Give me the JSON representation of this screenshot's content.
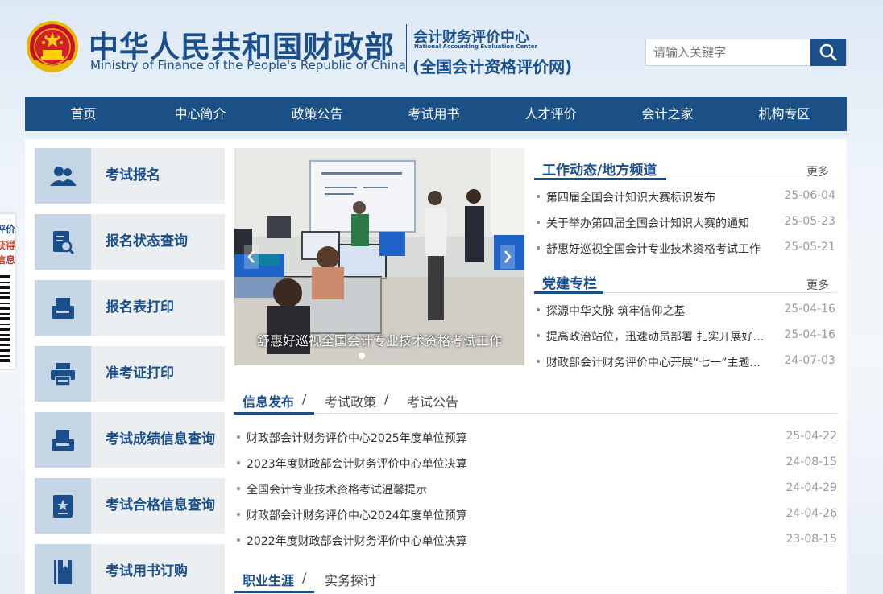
{
  "header": {
    "title_cn": "中华人民共和国财政部",
    "title_en": "Ministry of Finance of the People's Republic of China",
    "center_name": "会计财务评价中心",
    "center_name_en": "National Accounting Evaluation Center",
    "center_site": "(全国会计资格评价网)"
  },
  "search": {
    "placeholder": "请输入关键字",
    "value": ""
  },
  "nav": [
    "首页",
    "中心简介",
    "政策公告",
    "考试用书",
    "人才评价",
    "会计之家",
    "机构专区"
  ],
  "float_panel": {
    "line1": "评价",
    "line2": "获得",
    "line3": "信息"
  },
  "sidebar": [
    {
      "label": "考试报名",
      "icon": "users-icon"
    },
    {
      "label": "报名状态查询",
      "icon": "document-search-icon"
    },
    {
      "label": "报名表打印",
      "icon": "tray-icon"
    },
    {
      "label": "准考证打印",
      "icon": "printer-icon"
    },
    {
      "label": "考试成绩信息查询",
      "icon": "inbox-icon"
    },
    {
      "label": "考试合格信息查询",
      "icon": "certificate-icon"
    },
    {
      "label": "考试用书订购",
      "icon": "book-icon"
    }
  ],
  "slider": {
    "caption": "舒惠好巡视全国会计专业技术资格考试工作",
    "dot_count": 3,
    "active_dot": 1
  },
  "work_news": {
    "title": "工作动态/地方频道",
    "more": "更多",
    "items": [
      {
        "text": "第四届全国会计知识大赛标识发布",
        "date": "25-06-04"
      },
      {
        "text": "关于举办第四届全国会计知识大赛的通知",
        "date": "25-05-23"
      },
      {
        "text": "舒惠好巡视全国会计专业技术资格考试工作",
        "date": "25-05-21"
      }
    ]
  },
  "party": {
    "title": "党建专栏",
    "more": "更多",
    "items": [
      {
        "text": "探源中华文脉 筑牢信仰之基",
        "date": "25-04-16"
      },
      {
        "text": "提高政治站位，迅速动员部署 扎实开展好学...",
        "date": "25-04-16"
      },
      {
        "text": "财政部会计财务评价中心开展“七一”主题...",
        "date": "24-07-03"
      }
    ]
  },
  "info_tabs": {
    "tabs": [
      "信息发布",
      "考试政策",
      "考试公告"
    ],
    "separator": "/",
    "items": [
      {
        "text": "财政部会计财务评价中心2025年度单位预算",
        "date": "25-04-22"
      },
      {
        "text": "2023年度财政部会计财务评价中心单位决算",
        "date": "24-08-15"
      },
      {
        "text": "全国会计专业技术资格考试温馨提示",
        "date": "24-04-29"
      },
      {
        "text": "财政部会计财务评价中心2024年度单位预算",
        "date": "24-04-26"
      },
      {
        "text": "2022年度财政部会计财务评价中心单位决算",
        "date": "23-08-15"
      }
    ]
  },
  "career_tabs": {
    "tabs": [
      "职业生涯",
      "实务探讨"
    ],
    "separator": "/"
  },
  "colors": {
    "brand": "#1a4f8b",
    "nav_bg": "#1a5086",
    "icon_tile": "#c6d5e6"
  }
}
